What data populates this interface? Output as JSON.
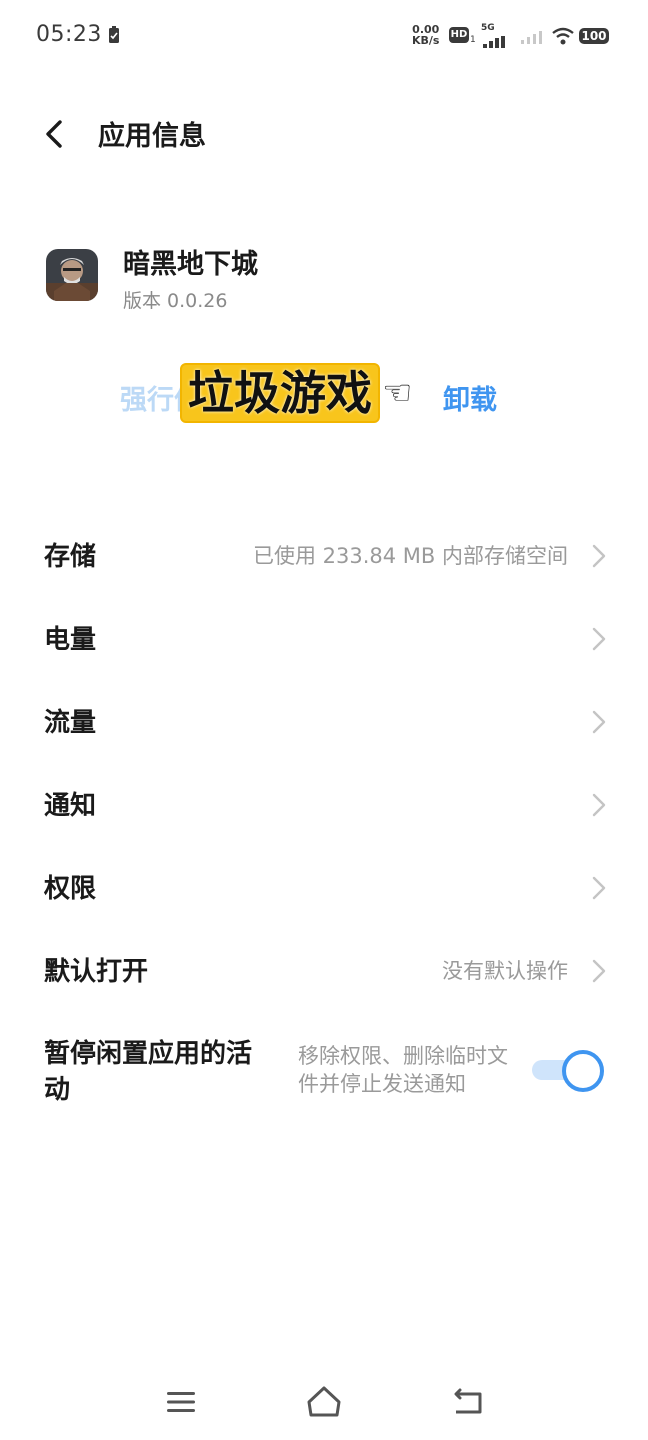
{
  "status_bar": {
    "time": "05:23",
    "net_speed_value": "0.00",
    "net_speed_unit": "KB/s",
    "hd_badge": "HD",
    "hd_sub": "1",
    "network_type": "5G",
    "battery": "100"
  },
  "header": {
    "title": "应用信息"
  },
  "app": {
    "name": "暗黑地下城",
    "version": "版本 0.0.26"
  },
  "actions": {
    "force_stop": "强行停止",
    "uninstall": "卸载"
  },
  "sticker": {
    "text": "垃圾游戏",
    "hand": "☜"
  },
  "settings": [
    {
      "label": "存储",
      "value": "已使用 233.84 MB 内部存储空间"
    },
    {
      "label": "电量",
      "value": ""
    },
    {
      "label": "流量",
      "value": ""
    },
    {
      "label": "通知",
      "value": ""
    },
    {
      "label": "权限",
      "value": ""
    },
    {
      "label": "默认打开",
      "value": "没有默认操作"
    }
  ],
  "pause_setting": {
    "label": "暂停闲置应用的活动",
    "description": "移除权限、删除临时文件并停止发送通知",
    "enabled": true
  },
  "colors": {
    "accent": "#3f95f0",
    "accent_light": "#bcd9f6",
    "sticker_bg": "#f8c51c"
  }
}
